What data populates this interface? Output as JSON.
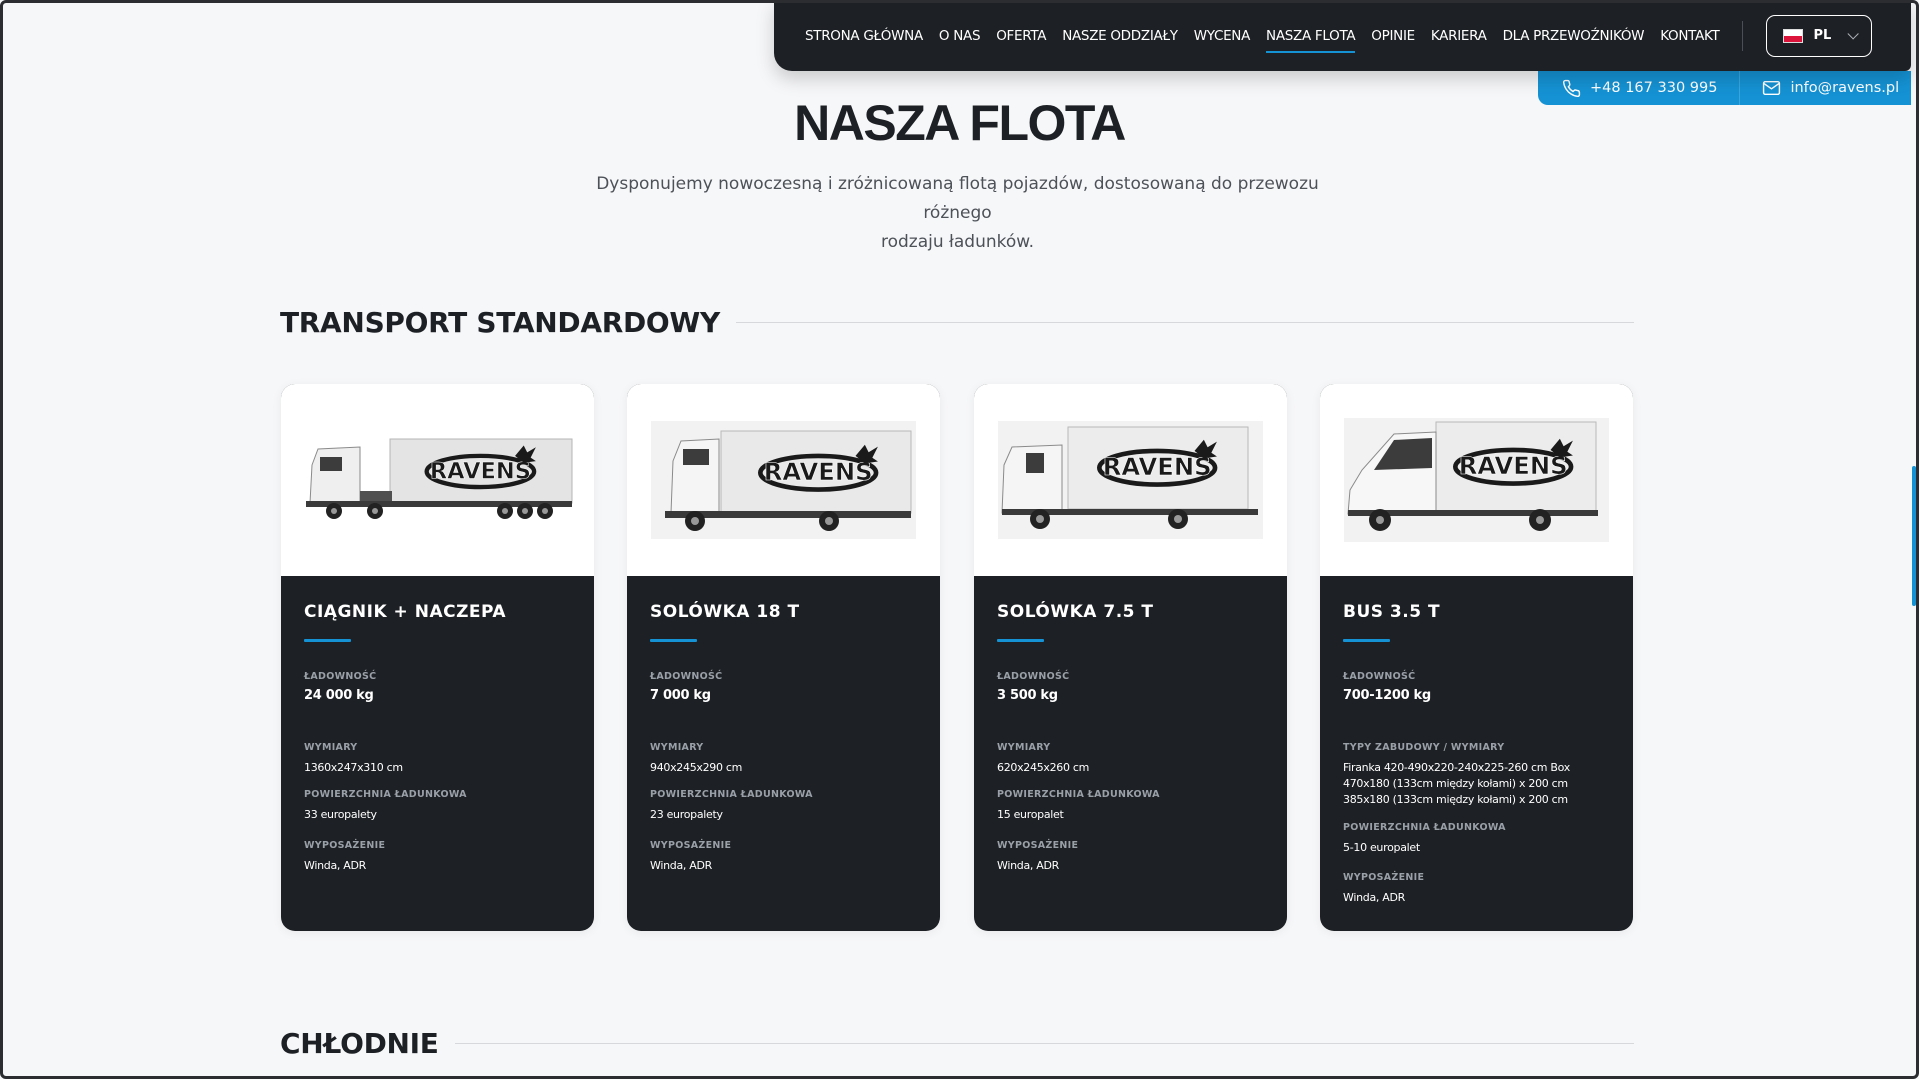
{
  "nav": {
    "items": [
      "STRONA GŁÓWNA",
      "O NAS",
      "OFERTA",
      "NASZE ODDZIAŁY",
      "WYCENA",
      "NASZA FLOTA",
      "OPINIE",
      "KARIERA",
      "DLA PRZEWOŹNIKÓW",
      "KONTAKT"
    ],
    "active": "NASZA FLOTA",
    "language": "PL"
  },
  "contact": {
    "phone": "+48 167 330 995",
    "email": "info@ravens.pl"
  },
  "hero": {
    "title": "NASZA FLOTA",
    "intro_line1": "Dysponujemy nowoczesną i zróżnicowaną flotą pojazdów, dostosowaną do przewozu różnego",
    "intro_line2": "rodzaju ładunków."
  },
  "sections": {
    "standard": "TRANSPORT STANDARDOWY",
    "cold": "CHŁODNIE"
  },
  "brand": {
    "logo_text": "RAVENS",
    "accent_color": "#1592d4",
    "dark_color": "#1d2024"
  },
  "cards": [
    {
      "title": "CIĄGNIK + NACZEPA",
      "capacity_label": "ŁADOWNOŚĆ",
      "capacity": "24 000 kg",
      "dims_label": "WYMIARY",
      "dims": "1360x247x310 cm",
      "area_label": "POWIERZCHNIA ŁADUNKOWA",
      "area": "33 europalety",
      "equip_label": "WYPOSAŻENIE",
      "equip": "Winda, ADR"
    },
    {
      "title": "SOLÓWKA 18 T",
      "capacity_label": "ŁADOWNOŚĆ",
      "capacity": "7 000 kg",
      "dims_label": "WYMIARY",
      "dims": "940x245x290 cm",
      "area_label": "POWIERZCHNIA ŁADUNKOWA",
      "area": "23 europalety",
      "equip_label": "WYPOSAŻENIE",
      "equip": "Winda, ADR"
    },
    {
      "title": "SOLÓWKA 7.5 T",
      "capacity_label": "ŁADOWNOŚĆ",
      "capacity": "3 500 kg",
      "dims_label": "WYMIARY",
      "dims": "620x245x260 cm",
      "area_label": "POWIERZCHNIA ŁADUNKOWA",
      "area": "15 europalet",
      "equip_label": "WYPOSAŻENIE",
      "equip": "Winda, ADR"
    },
    {
      "title": "BUS 3.5 T",
      "capacity_label": "ŁADOWNOŚĆ",
      "capacity": "700-1200 kg",
      "dims_label": "TYPY ZABUDOWY / WYMIARY",
      "dims_line1": "Firanka 420-490x220-240x225-260 cm Box",
      "dims_line2": "470x180 (133cm między kołami) x 200 cm",
      "dims_line3": "385x180 (133cm między kołami) x 200 cm",
      "area_label": "POWIERZCHNIA ŁADUNKOWA",
      "area": "5-10 europalet",
      "equip_label": "WYPOSAŻENIE",
      "equip": "Winda, ADR"
    }
  ]
}
